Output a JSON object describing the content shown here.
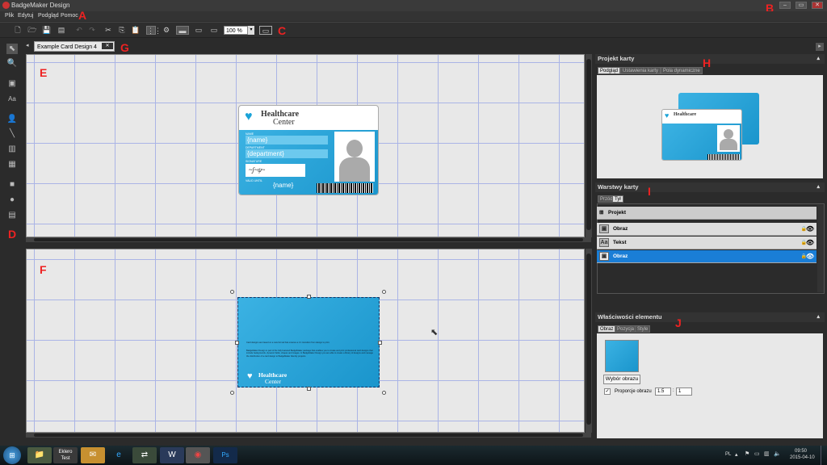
{
  "app": {
    "title": "BadgeMaker Design"
  },
  "window_controls": [
    "–",
    "▭",
    "✕"
  ],
  "menu": [
    "Plik",
    "Edytuj",
    "Podgląd",
    "Pomoc"
  ],
  "annotations": {
    "A": "A",
    "B": "B",
    "C": "C",
    "D": "D",
    "E": "E",
    "F": "F",
    "G": "G",
    "H": "H",
    "I": "I",
    "J": "J"
  },
  "toolbar": {
    "zoom": "100 %"
  },
  "tab": {
    "title": "Example Card Design 4",
    "close": "✕"
  },
  "front_card": {
    "org_line1": "Healthcare",
    "org_line2": "Center",
    "field_name_label": "NAME",
    "field_name_value": "{name}",
    "field_dept_label": "DEPARTMENT",
    "field_dept_value": "{department}",
    "signature_label": "SIGNATURE",
    "validity_label": "VALID UNTIL",
    "name_bottom": "{name}"
  },
  "back_card": {
    "text1": "Card designs are based on a new format that ensures a 1:1 transition from design to print.",
    "text2": "BadgeMaker Design is part of the fully featured BadgeMaker package that enables you to create and print professional card designs that include backgrounds, dynamic fields, shapes and images. In BadgeMaker Design you are able to create a library of designs and manage the distribution of a card design to BadgeMaker Identity projects.",
    "org_line1": "Healthcare",
    "org_line2": "Center"
  },
  "panels": {
    "project": {
      "title": "Projekt karty",
      "tabs": [
        "Podgląd",
        "Ustawienia karty",
        "Pola dynamiczne"
      ]
    },
    "layers": {
      "title": "Warstwy karty",
      "tabs": [
        "Przód",
        "Tył"
      ],
      "group": "Projekt",
      "items": [
        {
          "label": "Obraz",
          "icon": "image-icon"
        },
        {
          "label": "Tekst",
          "icon": "text-icon"
        },
        {
          "label": "Obraz",
          "icon": "image-icon"
        }
      ]
    },
    "properties": {
      "title": "Właściwości elementu",
      "tabs": [
        "Obraz",
        "Pozycja",
        "Style"
      ],
      "choose_image": "Wybór obrazu",
      "aspect_label": "Proporcje obrazu",
      "aspect_w": "1.5",
      "aspect_h": "1"
    }
  },
  "taskbar": {
    "lang": "PL",
    "time": "09:50",
    "date": "2015-04-10",
    "apps": [
      "start-icon",
      "explorer-icon",
      "eklero-test-icon",
      "outlook-icon",
      "ie-icon",
      "network-icon",
      "word-icon",
      "chrome-icon",
      "photoshop-icon"
    ],
    "eklero_line1": "Eklero",
    "eklero_line2": "Test",
    "ps": "Ps"
  },
  "colors": {
    "accent": "#1a7ed6",
    "annotation": "#e22222",
    "card": "#29a8dd"
  }
}
